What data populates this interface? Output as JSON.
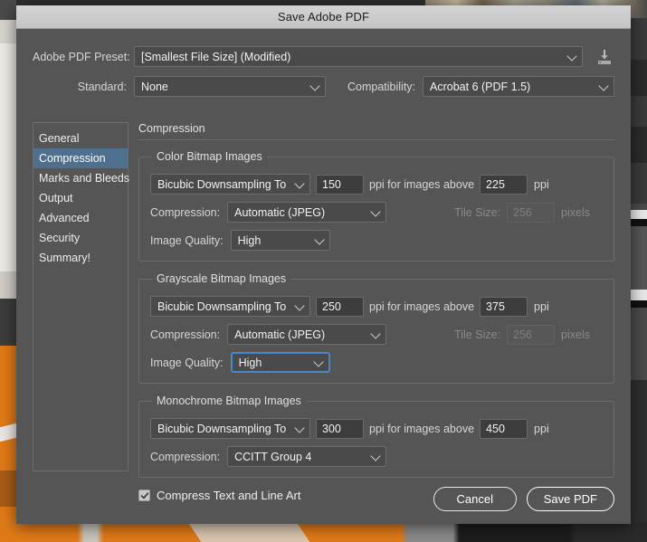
{
  "window": {
    "title": "Save Adobe PDF"
  },
  "preset": {
    "label": "Adobe PDF Preset:",
    "value": "[Smallest File Size] (Modified)",
    "save_icon": "save-preset-icon"
  },
  "standard": {
    "label": "Standard:",
    "value": "None"
  },
  "compatibility": {
    "label": "Compatibility:",
    "value": "Acrobat 6 (PDF 1.5)"
  },
  "sidebar": {
    "items": [
      {
        "label": "General",
        "active": false
      },
      {
        "label": "Compression",
        "active": true
      },
      {
        "label": "Marks and Bleeds",
        "active": false
      },
      {
        "label": "Output",
        "active": false
      },
      {
        "label": "Advanced",
        "active": false
      },
      {
        "label": "Security",
        "active": false
      },
      {
        "label": "Summary!",
        "active": false
      }
    ]
  },
  "panel": {
    "title": "Compression",
    "groups": [
      {
        "legend": "Color Bitmap Images",
        "downsample_method": "Bicubic Downsampling To",
        "downsample_ppi": "150",
        "mid_label": "ppi for images above",
        "threshold_ppi": "225",
        "ppi_unit": "ppi",
        "compression_label": "Compression:",
        "compression_value": "Automatic (JPEG)",
        "tile_size_label": "Tile Size:",
        "tile_size_value": "256",
        "tile_size_unit": "pixels",
        "quality_label": "Image Quality:",
        "quality_value": "High",
        "quality_focused": false,
        "has_quality": true,
        "has_tile": true
      },
      {
        "legend": "Grayscale Bitmap Images",
        "downsample_method": "Bicubic Downsampling To",
        "downsample_ppi": "250",
        "mid_label": "ppi for images above",
        "threshold_ppi": "375",
        "ppi_unit": "ppi",
        "compression_label": "Compression:",
        "compression_value": "Automatic (JPEG)",
        "tile_size_label": "Tile Size:",
        "tile_size_value": "256",
        "tile_size_unit": "pixels",
        "quality_label": "Image Quality:",
        "quality_value": "High",
        "quality_focused": true,
        "has_quality": true,
        "has_tile": true
      },
      {
        "legend": "Monochrome Bitmap Images",
        "downsample_method": "Bicubic Downsampling To",
        "downsample_ppi": "300",
        "mid_label": "ppi for images above",
        "threshold_ppi": "450",
        "ppi_unit": "ppi",
        "compression_label": "Compression:",
        "compression_value": "CCITT Group 4",
        "has_quality": false,
        "has_tile": false
      }
    ],
    "compress_text_checkbox": {
      "label": "Compress Text and Line Art",
      "checked": true
    }
  },
  "footer": {
    "cancel_label": "Cancel",
    "save_label": "Save PDF"
  },
  "colors": {
    "dialog_bg": "#555555",
    "titlebar_bg": "#cccccc",
    "accent_selection": "#4f6f8f",
    "focus_ring": "#4a87c4",
    "field_bg": "#3d3d3d",
    "text": "#ececec",
    "disabled_text": "#8a8a8a"
  }
}
